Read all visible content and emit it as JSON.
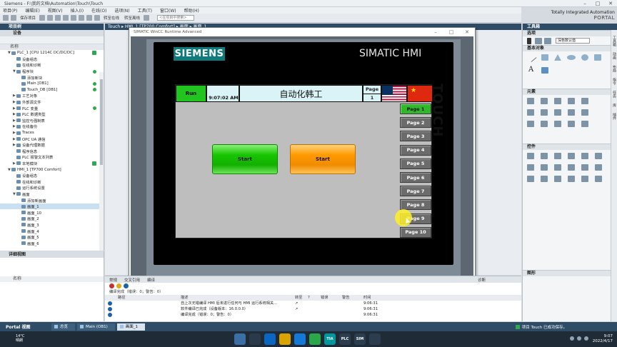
{
  "window": {
    "title": "Siemens - F:\\我的文档\\Automation\\Touch\\Touch"
  },
  "menu": [
    "项目(P)",
    "编辑(E)",
    "视图(V)",
    "插入(I)",
    "在线(O)",
    "选项(N)",
    "工具(T)",
    "窗口(W)",
    "帮助(H)"
  ],
  "toolbar": {
    "save_label": "保存项目",
    "online_label": "转至在线",
    "offline_label": "转至离线",
    "search_placeholder": "<在项目中搜索>"
  },
  "brand": {
    "line1": "Totally Integrated Automation",
    "line2": "PORTAL"
  },
  "project": {
    "title": "项目树",
    "tab": "设备",
    "column": "名称",
    "tree": [
      {
        "label": "PLC_1 [CPU 1214C DC/DC/DC]",
        "indent": 1,
        "exp": "▼",
        "status": "chk"
      },
      {
        "label": "设备组态",
        "indent": 2,
        "exp": "",
        "status": ""
      },
      {
        "label": "在线和诊断",
        "indent": 2,
        "exp": "",
        "status": ""
      },
      {
        "label": "程序块",
        "indent": 2,
        "exp": "▼",
        "status": "dot"
      },
      {
        "label": "添加新块",
        "indent": 3,
        "exp": "",
        "status": ""
      },
      {
        "label": "Main [OB1]",
        "indent": 3,
        "exp": "",
        "status": "dot"
      },
      {
        "label": "Touch_DB [DB1]",
        "indent": 3,
        "exp": "",
        "status": "dot"
      },
      {
        "label": "工艺对象",
        "indent": 2,
        "exp": "▶",
        "status": ""
      },
      {
        "label": "外部源文件",
        "indent": 2,
        "exp": "▶",
        "status": ""
      },
      {
        "label": "PLC 变量",
        "indent": 2,
        "exp": "▶",
        "status": "dot"
      },
      {
        "label": "PLC 数据类型",
        "indent": 2,
        "exp": "▶",
        "status": ""
      },
      {
        "label": "监控与强制表",
        "indent": 2,
        "exp": "▶",
        "status": ""
      },
      {
        "label": "在线备份",
        "indent": 2,
        "exp": "▶",
        "status": ""
      },
      {
        "label": "Traces",
        "indent": 2,
        "exp": "▶",
        "status": ""
      },
      {
        "label": "OPC UA 通信",
        "indent": 2,
        "exp": "▶",
        "status": ""
      },
      {
        "label": "设备代理数据",
        "indent": 2,
        "exp": "▶",
        "status": ""
      },
      {
        "label": "程序信息",
        "indent": 2,
        "exp": "",
        "status": ""
      },
      {
        "label": "PLC 报警文本列表",
        "indent": 2,
        "exp": "",
        "status": ""
      },
      {
        "label": "本地模块",
        "indent": 2,
        "exp": "▶",
        "status": "chk"
      },
      {
        "label": "HMI_1 [TP700 Comfort]",
        "indent": 1,
        "exp": "▼",
        "status": ""
      },
      {
        "label": "设备组态",
        "indent": 2,
        "exp": "",
        "status": ""
      },
      {
        "label": "在线和诊断",
        "indent": 2,
        "exp": "",
        "status": ""
      },
      {
        "label": "运行系统设置",
        "indent": 2,
        "exp": "",
        "status": ""
      },
      {
        "label": "画面",
        "indent": 2,
        "exp": "▼",
        "status": ""
      },
      {
        "label": "添加新画面",
        "indent": 3,
        "exp": "",
        "status": ""
      },
      {
        "label": "画面_1",
        "indent": 3,
        "exp": "",
        "status": "",
        "sel": true
      },
      {
        "label": "画面_10",
        "indent": 3,
        "exp": "",
        "status": ""
      },
      {
        "label": "画面_2",
        "indent": 3,
        "exp": "",
        "status": ""
      },
      {
        "label": "画面_3",
        "indent": 3,
        "exp": "",
        "status": ""
      },
      {
        "label": "画面_4",
        "indent": 3,
        "exp": "",
        "status": ""
      },
      {
        "label": "画面_5",
        "indent": 3,
        "exp": "",
        "status": ""
      },
      {
        "label": "画面_6",
        "indent": 3,
        "exp": "",
        "status": ""
      }
    ]
  },
  "details": {
    "title": "详细视图",
    "column": "名称"
  },
  "editor": {
    "breadcrumb": "Touch ▸ HMI_1 [TP700 Comfort] ▸ 画面 ▸ 画面_1"
  },
  "runtime": {
    "title": "SIMATIC WinCC Runtime Advanced",
    "brand_logo": "SIEMENS",
    "brand_product": "SIMATIC HMI",
    "side_label": "TOUCH",
    "hmi": {
      "run_label": "Run",
      "time": "9:07:02 AM",
      "title": "自动化韩工",
      "page_label": "Page",
      "page_number": "1",
      "start_green": "Start",
      "start_orange": "Start",
      "pages": [
        "Page 1",
        "Page 2",
        "Page 3",
        "Page 4",
        "Page 5",
        "Page 6",
        "Page 7",
        "Page 8",
        "Page 9",
        "Page 10"
      ],
      "active_page": 0
    }
  },
  "tasks": {
    "title": "工具箱",
    "options": "选项",
    "style_value": "深色数认值",
    "basic_objects": "基本对象",
    "elements": "元素",
    "controls": "控件",
    "graphics": "图形",
    "side_tabs": [
      "工具箱",
      "动画",
      "布局",
      "指令",
      "任务",
      "库",
      "插件"
    ]
  },
  "bottom": {
    "tabs": [
      "常规",
      "交叉引用",
      "编译"
    ],
    "diag": "诊断",
    "summary": "编译完成（错误：0；警告：0）",
    "headers": [
      "",
      "路径",
      "描述",
      "转至",
      "?",
      "错误",
      "警告",
      "时间"
    ],
    "rows": [
      {
        "path": "",
        "desc": "自上次无错编译 HMI 后未进行任何与 HMI 运行系统相关...",
        "goto": "↗",
        "err": "",
        "warn": "",
        "time": "9:06:31"
      },
      {
        "path": "",
        "desc": "软件编译已完成（设备版本：16.0.0.0）",
        "goto": "↗",
        "err": "",
        "warn": "",
        "time": "9:06:31"
      },
      {
        "path": "",
        "desc": "编译完成（错误：0；警告：0）",
        "goto": "",
        "err": "",
        "warn": "",
        "time": "9:06:31"
      }
    ]
  },
  "portal": {
    "view": "Portal 视图",
    "tabs": [
      "总览",
      "Main (OB1)",
      "画面_1"
    ],
    "active_tab": 2,
    "message": "项目 Touch 已成功保存。"
  },
  "taskbar": {
    "temp": "14°C",
    "weather": "晴朗",
    "time": "9:07",
    "date": "2022/4/17",
    "apps": [
      {
        "label": "",
        "color": "#3a6ea5"
      },
      {
        "label": "",
        "color": "#2a3a4a"
      },
      {
        "label": "",
        "color": "#0a66c2"
      },
      {
        "label": "",
        "color": "#d9a400"
      },
      {
        "label": "",
        "color": "#1479d6"
      },
      {
        "label": "",
        "color": "#2aa748"
      },
      {
        "label": "TIA",
        "color": "#00979d"
      },
      {
        "label": "PLC",
        "color": "#2b3d4f"
      },
      {
        "label": "SIM",
        "color": "#2b3d4f"
      },
      {
        "label": "",
        "color": "#2b3d4f"
      }
    ]
  }
}
